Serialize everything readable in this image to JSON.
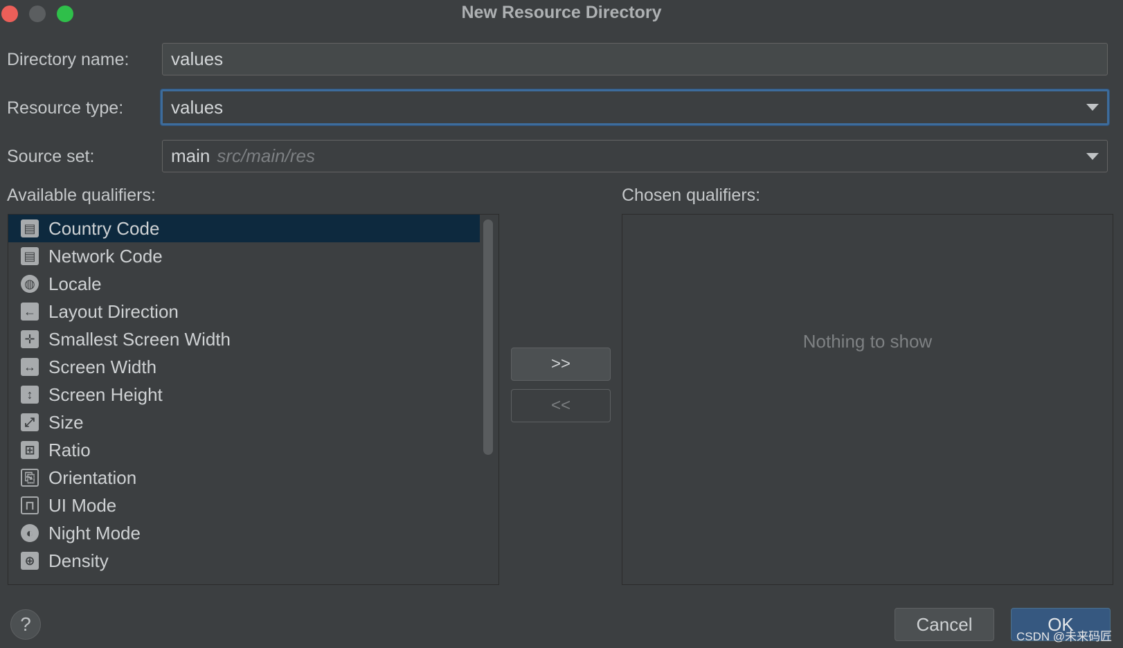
{
  "window": {
    "title": "New Resource Directory"
  },
  "form": {
    "directory_name_label": "Directory name:",
    "directory_name_value": "values",
    "resource_type_label": "Resource type:",
    "resource_type_value": "values",
    "source_set_label": "Source set:",
    "source_set_value": "main",
    "source_set_hint": "src/main/res"
  },
  "qualifiers": {
    "available_label": "Available qualifiers:",
    "chosen_label": "Chosen qualifiers:",
    "available": [
      {
        "label": "Country Code",
        "icon": "country-code-icon"
      },
      {
        "label": "Network Code",
        "icon": "network-code-icon"
      },
      {
        "label": "Locale",
        "icon": "globe-icon"
      },
      {
        "label": "Layout Direction",
        "icon": "layout-direction-icon"
      },
      {
        "label": "Smallest Screen Width",
        "icon": "smallest-screen-width-icon"
      },
      {
        "label": "Screen Width",
        "icon": "screen-width-icon"
      },
      {
        "label": "Screen Height",
        "icon": "screen-height-icon"
      },
      {
        "label": "Size",
        "icon": "size-icon"
      },
      {
        "label": "Ratio",
        "icon": "ratio-icon"
      },
      {
        "label": "Orientation",
        "icon": "orientation-icon"
      },
      {
        "label": "UI Mode",
        "icon": "ui-mode-icon"
      },
      {
        "label": "Night Mode",
        "icon": "night-mode-icon"
      },
      {
        "label": "Density",
        "icon": "density-icon"
      }
    ],
    "selected_index": 0,
    "chosen_empty_text": "Nothing to show"
  },
  "buttons": {
    "add": ">>",
    "remove": "<<",
    "help": "?",
    "cancel": "Cancel",
    "ok": "OK"
  },
  "watermark": "CSDN @未来码匠"
}
